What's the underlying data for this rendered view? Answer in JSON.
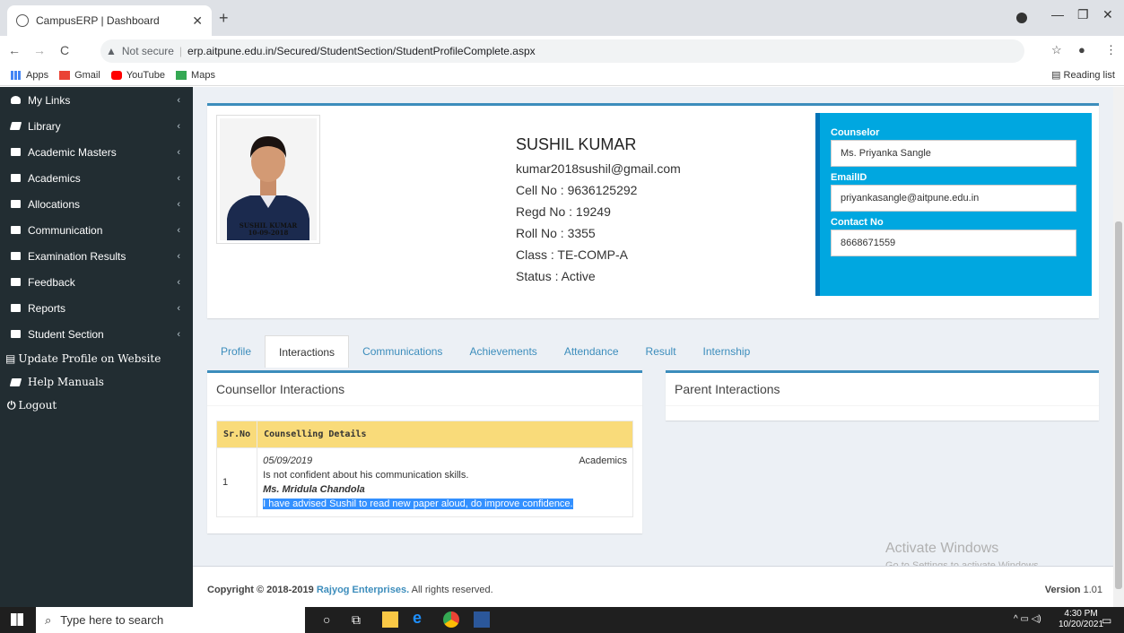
{
  "browser": {
    "tab_title": "CampusERP | Dashboard",
    "not_secure": "Not secure",
    "url": "erp.aitpune.edu.in/Secured/StudentSection/StudentProfileComplete.aspx",
    "bookmarks": [
      "Apps",
      "Gmail",
      "YouTube",
      "Maps"
    ],
    "reading_list": "Reading list"
  },
  "sidebar": {
    "items": [
      {
        "label": "My Links",
        "icon": "user-icon"
      },
      {
        "label": "Library",
        "icon": "book-icon"
      },
      {
        "label": "Academic Masters",
        "icon": "folder-icon"
      },
      {
        "label": "Academics",
        "icon": "folder-icon"
      },
      {
        "label": "Allocations",
        "icon": "folder-icon"
      },
      {
        "label": "Communication",
        "icon": "folder-icon"
      },
      {
        "label": "Examination Results",
        "icon": "folder-icon"
      },
      {
        "label": "Feedback",
        "icon": "folder-icon"
      },
      {
        "label": "Reports",
        "icon": "folder-icon"
      },
      {
        "label": "Student Section",
        "icon": "folder-icon"
      }
    ],
    "update_profile": "Update Profile on Website",
    "help_manuals": "Help Manuals",
    "logout": "Logout"
  },
  "student": {
    "photo_name": "SUSHIL KUMAR",
    "photo_date": "10-09-2018",
    "name": "SUSHIL KUMAR",
    "email": "kumar2018sushil@gmail.com",
    "cell": "Cell No : 9636125292",
    "regd": "Regd No : 19249",
    "roll": "Roll No : 3355",
    "class": "Class : TE-COMP-A",
    "status": "Status : Active"
  },
  "counselor": {
    "counselor_label": "Counselor",
    "counselor_name": "Ms. Priyanka Sangle",
    "email_label": "EmailID",
    "email": "priyankasangle@aitpune.edu.in",
    "contact_label": "Contact No",
    "contact": "8668671559"
  },
  "tabs": [
    "Profile",
    "Interactions",
    "Communications",
    "Achievements",
    "Attendance",
    "Result",
    "Internship"
  ],
  "active_tab": "Interactions",
  "counsellor_interactions": {
    "title": "Counsellor Interactions",
    "headers": [
      "Sr.No",
      "Counselling Details"
    ],
    "rows": [
      {
        "sr": "1",
        "date": "05/09/2019",
        "category": "Academics",
        "note": "Is not confident about his communication skills.",
        "counsellor": "Ms. Mridula Chandola",
        "advice": "I have advised Sushil to read new paper aloud, do improve confidence."
      }
    ]
  },
  "parent_interactions": {
    "title": "Parent Interactions"
  },
  "footer": {
    "copyright": "Copyright © 2018-2019",
    "company": "Rajyog Enterprises.",
    "rights": "All rights reserved.",
    "version_label": "Version",
    "version": "1.01"
  },
  "watermark": {
    "line1": "Activate Windows",
    "line2": "Go to Settings to activate Windows."
  },
  "taskbar": {
    "search_placeholder": "Type here to search",
    "time": "4:30 PM",
    "date": "10/20/2021"
  },
  "colors": {
    "sidebar": "#222d32",
    "accent": "#3c8dbc",
    "counselor_box": "#00a7e0",
    "table_header": "#f9db7a"
  }
}
